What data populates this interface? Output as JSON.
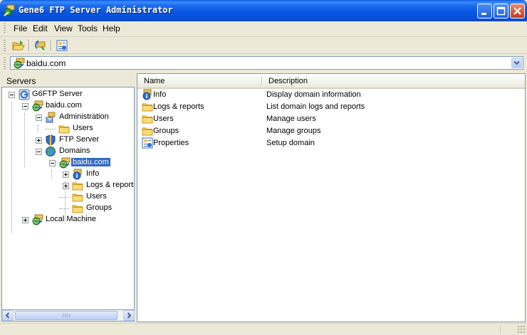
{
  "window": {
    "title": "Gene6 FTP Server Administrator",
    "caption_buttons": [
      "minimize-icon",
      "maximize-icon",
      "close-icon"
    ]
  },
  "menu": {
    "items": [
      {
        "label": "File"
      },
      {
        "label": "Edit"
      },
      {
        "label": "View"
      },
      {
        "label": "Tools"
      },
      {
        "label": "Help"
      }
    ]
  },
  "toolbar": {
    "buttons": [
      {
        "icon": "open-folder-icon"
      },
      {
        "icon": "refresh-icon"
      },
      {
        "icon": "properties-icon"
      }
    ]
  },
  "address": {
    "value": "baidu.com",
    "icon": "domain-icon"
  },
  "servers_panel": {
    "label": "Servers",
    "tree": [
      {
        "label": "G6FTP Server",
        "icon": "server-icon",
        "level": 0,
        "expander": "minus"
      },
      {
        "label": "baidu.com",
        "icon": "domain-icon",
        "level": 1,
        "expander": "minus"
      },
      {
        "label": "Administration",
        "icon": "admin-icon",
        "level": 2,
        "expander": "minus"
      },
      {
        "label": "Users",
        "icon": "folder-icon",
        "level": 3,
        "expander": "none"
      },
      {
        "label": "FTP Server",
        "icon": "shield-icon",
        "level": 2,
        "expander": "plus"
      },
      {
        "label": "Domains",
        "icon": "globe-icon",
        "level": 2,
        "expander": "minus"
      },
      {
        "label": "baidu.com",
        "icon": "domain-icon",
        "level": 3,
        "expander": "minus",
        "selected": true
      },
      {
        "label": "Info",
        "icon": "info-icon",
        "level": 4,
        "expander": "plus"
      },
      {
        "label": "Logs & reports",
        "icon": "folder-icon",
        "level": 4,
        "expander": "plus"
      },
      {
        "label": "Users",
        "icon": "folder-icon",
        "level": 4,
        "expander": "none"
      },
      {
        "label": "Groups",
        "icon": "folder-icon",
        "level": 4,
        "expander": "none"
      },
      {
        "label": "Local Machine",
        "icon": "domain-icon",
        "level": 1,
        "expander": "plus"
      }
    ]
  },
  "list": {
    "columns": [
      "Name",
      "Description"
    ],
    "rows": [
      {
        "name": "Info",
        "description": "Display domain information",
        "icon": "info-icon"
      },
      {
        "name": "Logs & reports",
        "description": "List domain logs and reports",
        "icon": "folder-icon"
      },
      {
        "name": "Users",
        "description": "Manage users",
        "icon": "folder-icon"
      },
      {
        "name": "Groups",
        "description": "Manage groups",
        "icon": "folder-icon"
      },
      {
        "name": "Properties",
        "description": "Setup domain",
        "icon": "properties-icon"
      }
    ]
  },
  "colors": {
    "titlebar": "#0755df",
    "selection": "#316ac5",
    "folder": "#f5c84b",
    "close_button": "#c8391a"
  }
}
